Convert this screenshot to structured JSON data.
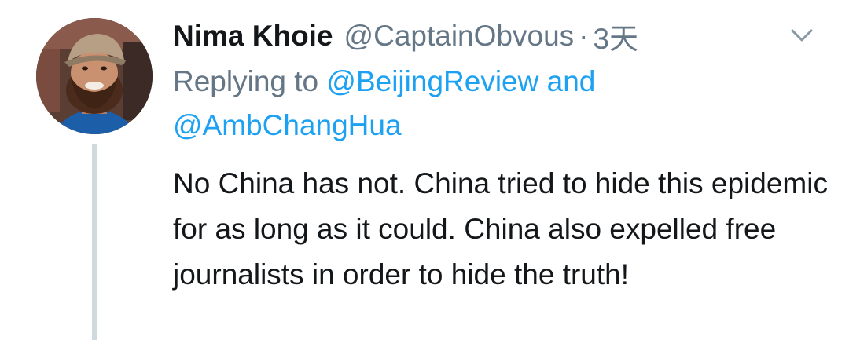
{
  "tweet": {
    "author_name": "Nima Khoie",
    "author_handle": "@CaptainObvous",
    "separator": "·",
    "timestamp": "3天",
    "reply_prefix": "Replying to",
    "reply_handle_1": "@BeijingReview",
    "reply_joiner": "and",
    "reply_handle_2": "@AmbChangHua",
    "text": "No China has not. China tried to hide this epidemic for as long as it could. China also expelled free journalists in order to hide the truth!"
  },
  "icons": {
    "menu": "chevron-down-icon",
    "avatar": "avatar"
  },
  "colors": {
    "link": "#1da1f2",
    "secondary_text": "#657786",
    "primary_text": "#14171a",
    "thread_line": "#cfd9de"
  }
}
